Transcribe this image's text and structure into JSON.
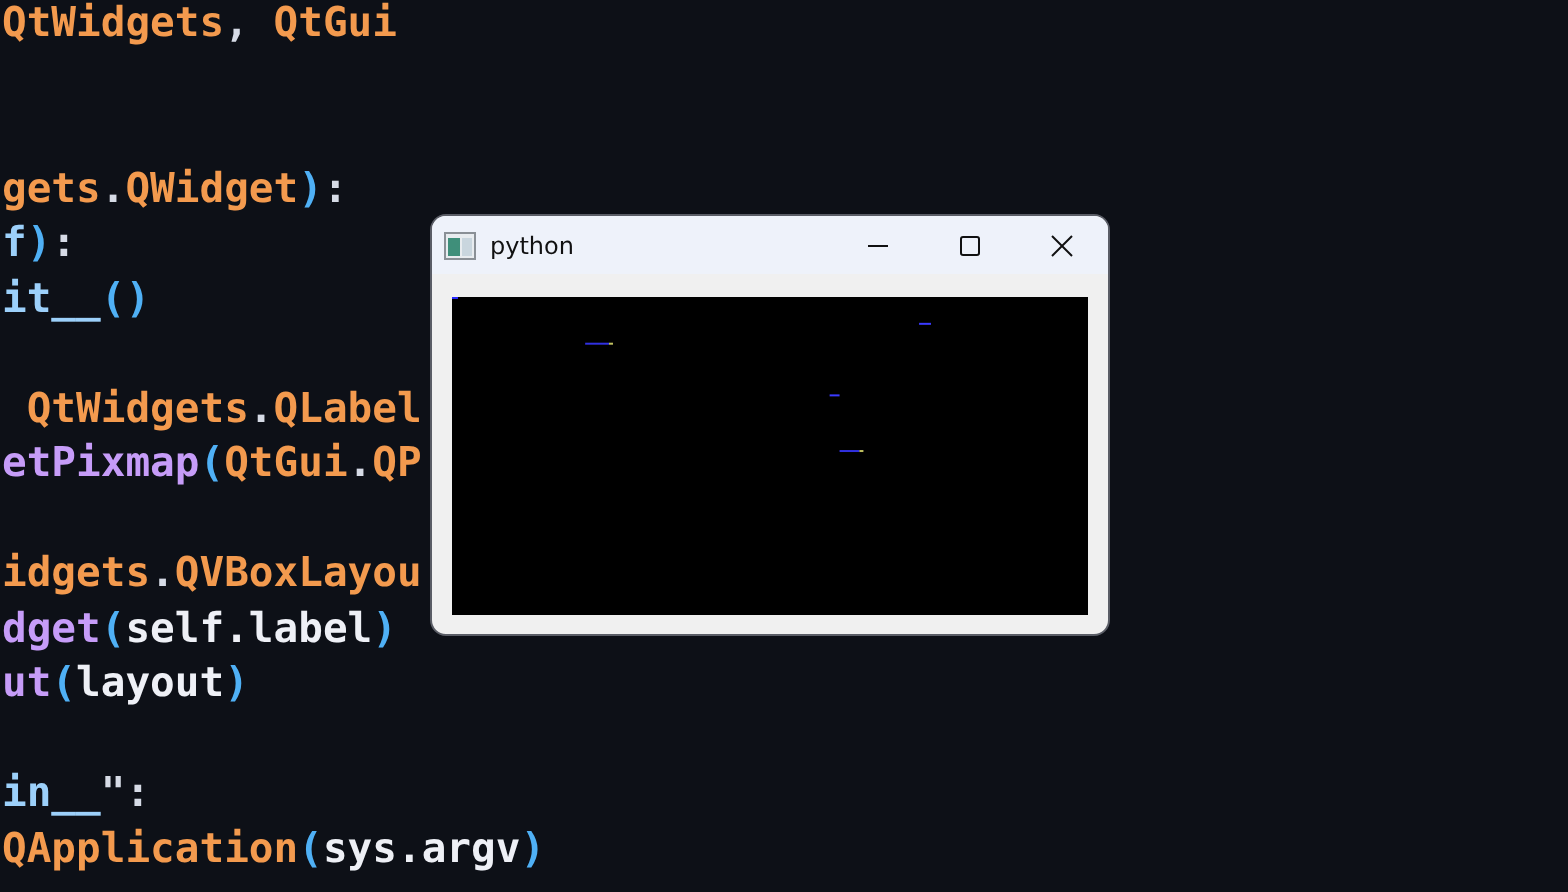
{
  "editor": {
    "header": [
      {
        "text": "QtWidgets",
        "kind": "ns"
      },
      {
        "text": ", ",
        "kind": "punct"
      },
      {
        "text": "QtGui",
        "kind": "ns"
      }
    ],
    "blocks": [
      [
        [
          {
            "text": "gets",
            "kind": "ns"
          },
          {
            "text": ".",
            "kind": "punct"
          },
          {
            "text": "QWidget",
            "kind": "ns"
          },
          {
            "text": ")",
            "kind": "paren"
          },
          {
            "text": ":",
            "kind": "punct"
          }
        ],
        [
          {
            "text": "f",
            "kind": "ident"
          },
          {
            "text": ")",
            "kind": "paren"
          },
          {
            "text": ":",
            "kind": "punct"
          }
        ],
        [
          {
            "text": "it__",
            "kind": "ident"
          },
          {
            "text": "()",
            "kind": "paren"
          }
        ]
      ],
      [
        [
          {
            "text": " QtWidgets",
            "kind": "ns"
          },
          {
            "text": ".",
            "kind": "punct"
          },
          {
            "text": "QLabel",
            "kind": "ns"
          }
        ],
        [
          {
            "text": "etPixmap",
            "kind": "method"
          },
          {
            "text": "(",
            "kind": "paren"
          },
          {
            "text": "QtGui",
            "kind": "ns"
          },
          {
            "text": ".",
            "kind": "punct"
          },
          {
            "text": "QP",
            "kind": "ns"
          }
        ]
      ],
      [
        [
          {
            "text": "idgets",
            "kind": "ns"
          },
          {
            "text": ".",
            "kind": "punct"
          },
          {
            "text": "QVBoxLayou",
            "kind": "ns"
          }
        ],
        [
          {
            "text": "dget",
            "kind": "method"
          },
          {
            "text": "(",
            "kind": "paren"
          },
          {
            "text": "self.label",
            "kind": "var"
          },
          {
            "text": ")",
            "kind": "paren"
          }
        ],
        [
          {
            "text": "ut",
            "kind": "method"
          },
          {
            "text": "(",
            "kind": "paren"
          },
          {
            "text": "layout",
            "kind": "var"
          },
          {
            "text": ")",
            "kind": "paren"
          }
        ]
      ],
      [
        [
          {
            "text": "in__",
            "kind": "ident"
          },
          {
            "text": "\":",
            "kind": "punct"
          }
        ],
        [
          {
            "text": "QApplication",
            "kind": "ns"
          },
          {
            "text": "(",
            "kind": "paren"
          },
          {
            "text": "sys.argv",
            "kind": "var"
          },
          {
            "text": ")",
            "kind": "paren"
          }
        ]
      ]
    ]
  },
  "window": {
    "title": "python"
  }
}
